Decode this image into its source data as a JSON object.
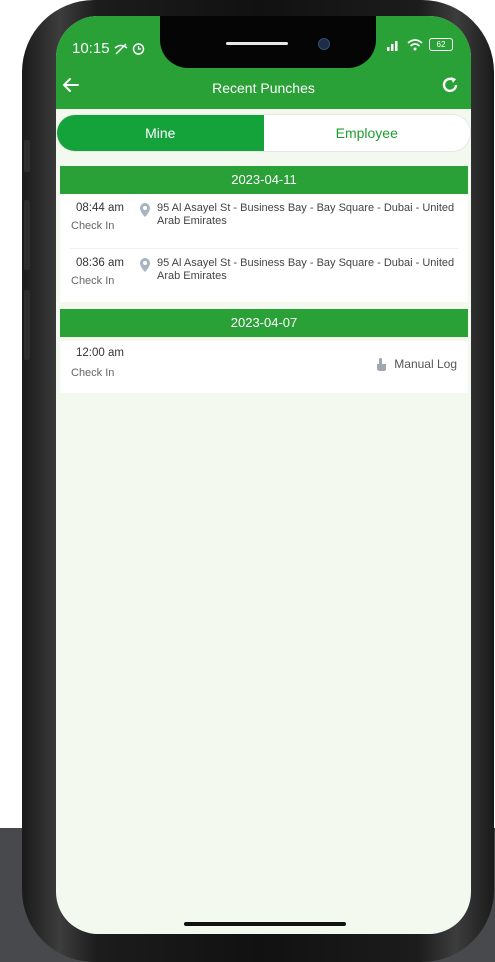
{
  "status_bar": {
    "time": "10:15",
    "battery": "62"
  },
  "header": {
    "title": "Recent Punches",
    "back_icon": "arrow-left-icon",
    "refresh_icon": "refresh-icon",
    "color": "#2aa136"
  },
  "tabs": [
    {
      "label": "Mine",
      "active": true
    },
    {
      "label": "Employee",
      "active": false
    }
  ],
  "groups": [
    {
      "date": "2023-04-11",
      "entries": [
        {
          "time": "08:44 am",
          "type": "Check In",
          "address": "95 Al Asayel St - Business Bay - Bay Square - Dubai - United Arab Emirates",
          "icon": "location-pin-icon"
        },
        {
          "time": "08:36 am",
          "type": "Check In",
          "address": "95 Al Asayel St - Business Bay - Bay Square - Dubai - United Arab Emirates",
          "icon": "location-pin-icon"
        }
      ]
    },
    {
      "date": "2023-04-07",
      "entries": [
        {
          "time": "12:00 am",
          "type": "Check In",
          "source": "Manual Log",
          "icon": "hand-pointer-icon"
        }
      ]
    }
  ]
}
